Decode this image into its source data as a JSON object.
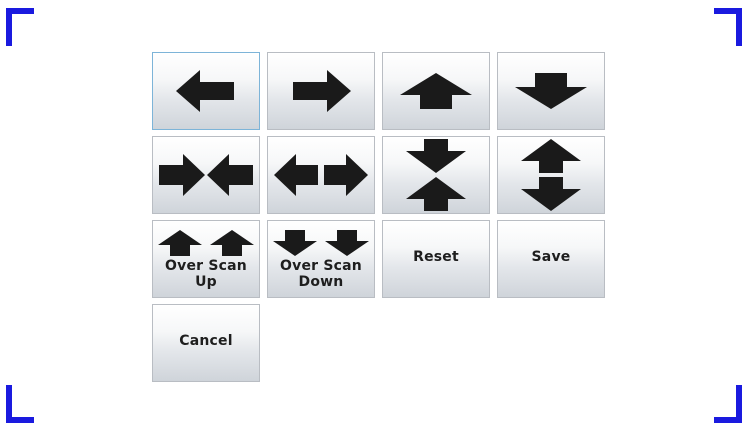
{
  "colors": {
    "corner_marks": "#1a1adf",
    "arrow": "#1a1a1a",
    "selected_border": "#7db4d8"
  },
  "buttons": {
    "move_left": {
      "icon": "arrow-left-icon"
    },
    "move_right": {
      "icon": "arrow-right-icon"
    },
    "move_up": {
      "icon": "arrow-up-icon"
    },
    "move_down": {
      "icon": "arrow-down-icon"
    },
    "shrink_horizontal": {
      "icon": "arrows-inward-horizontal-icon"
    },
    "expand_horizontal": {
      "icon": "arrows-outward-horizontal-icon"
    },
    "shrink_vertical": {
      "icon": "arrows-inward-vertical-icon"
    },
    "expand_vertical": {
      "icon": "arrows-outward-vertical-icon"
    },
    "over_scan_up": {
      "icon": "double-arrow-up-icon",
      "line1": "Over Scan",
      "line2": "Up"
    },
    "over_scan_down": {
      "icon": "double-arrow-down-icon",
      "line1": "Over Scan",
      "line2": "Down"
    },
    "reset": {
      "label": "Reset"
    },
    "save": {
      "label": "Save"
    },
    "cancel": {
      "label": "Cancel"
    }
  }
}
